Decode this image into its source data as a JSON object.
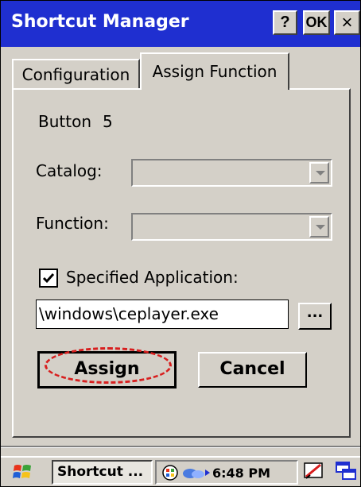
{
  "window": {
    "title": "Shortcut Manager",
    "help_label": "?",
    "ok_label": "OK",
    "close_label": "×"
  },
  "tabs": [
    {
      "label": "Configuration",
      "selected": false
    },
    {
      "label": "Assign Function",
      "selected": true
    }
  ],
  "form": {
    "button_label": "Button",
    "button_number": "5",
    "catalog_label": "Catalog:",
    "catalog_value": "",
    "function_label": "Function:",
    "function_value": "",
    "specified_app_label": "Specified Application:",
    "specified_app_checked": true,
    "app_path": "\\windows\\ceplayer.exe",
    "browse_label": "...",
    "assign_label": "Assign",
    "cancel_label": "Cancel"
  },
  "taskbar": {
    "task_label": "Shortcut ...",
    "clock": "6:48 PM"
  },
  "colors": {
    "titlebar": "#1f2fd0",
    "face": "#d4d0c8",
    "highlight_circle": "#d81e1e"
  },
  "icons": [
    "windows-flag-icon",
    "help-icon",
    "ok-icon",
    "close-icon",
    "dropdown-arrow-icon",
    "checkmark-icon",
    "network-icon",
    "connection-icon",
    "desktop-icon",
    "window-switch-icon"
  ]
}
